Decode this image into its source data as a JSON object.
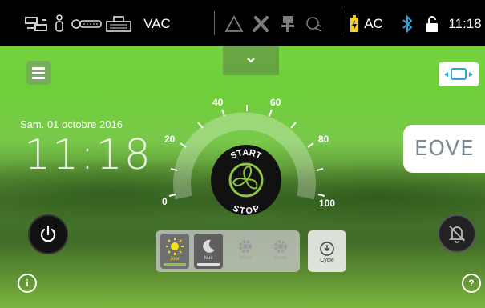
{
  "status_bar": {
    "mode_text": "VAC",
    "power_text": "AC",
    "time": "11:18",
    "icons": [
      "network-sync-icon",
      "patient-icon",
      "circuit-icon",
      "humidifier-icon",
      "warning-triangle-icon",
      "tools-icon",
      "cable-icon",
      "oxygen-icon",
      "battery-charging-icon",
      "bluetooth-icon",
      "unlock-icon"
    ]
  },
  "datetime": {
    "date": "Sam. 01 octobre 2016",
    "time": "11:18"
  },
  "brand": {
    "logo_text": "EOVE"
  },
  "gauge": {
    "labels": [
      "0",
      "20",
      "40",
      "60",
      "80",
      "100"
    ],
    "start_label": "START",
    "stop_label": "STOP"
  },
  "modes": {
    "items": [
      {
        "label": "Jour",
        "icon": "sun-icon",
        "active": true
      },
      {
        "label": "Nuit",
        "icon": "moon-icon",
        "active": false
      },
      {
        "label": "Prese",
        "icon": "preset-gear-icon",
        "active": false
      },
      {
        "label": "Prese",
        "icon": "preset-gear-icon",
        "active": false
      }
    ],
    "cycle_label": "Cycle"
  },
  "colors": {
    "accent": "#7ed84a",
    "status_bar": "#000000",
    "bluetooth": "#29a8e0",
    "battery": "#f0d020",
    "sun": "#f2e21a"
  }
}
